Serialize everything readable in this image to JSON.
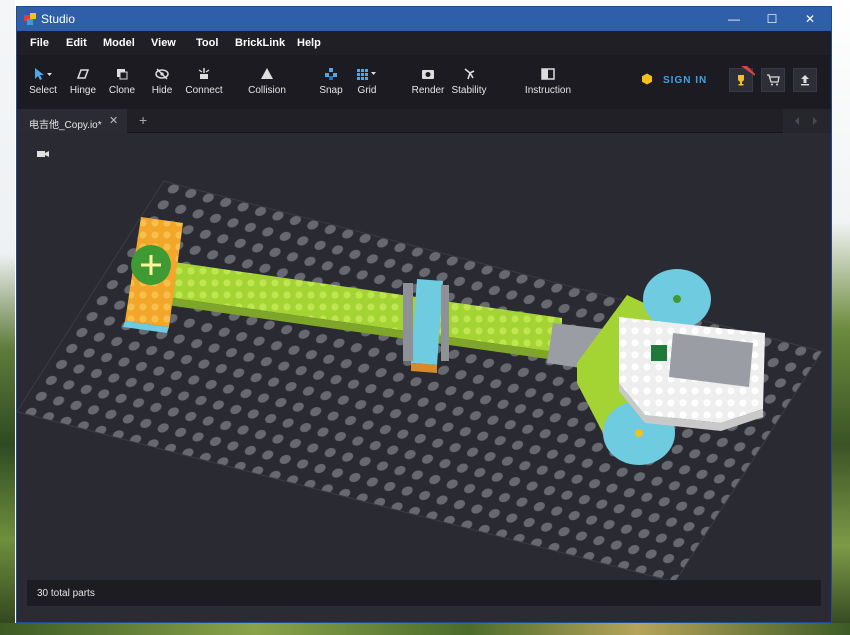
{
  "window": {
    "title": "Studio",
    "controls": {
      "minimize": "—",
      "maximize": "☐",
      "close": "✕"
    }
  },
  "menu": [
    "File",
    "Edit",
    "Model",
    "View",
    "Tool",
    "BrickLink",
    "Help"
  ],
  "toolbar": {
    "select": "Select",
    "hinge": "Hinge",
    "clone": "Clone",
    "hide": "Hide",
    "connect": "Connect",
    "collision": "Collision",
    "snap": "Snap",
    "grid": "Grid",
    "render": "Render",
    "stability": "Stability",
    "instruction": "Instruction",
    "sign_in": "SIGN IN"
  },
  "tabs": {
    "active": "电吉他_Copy.io*",
    "close": "✕",
    "add": "+"
  },
  "status": {
    "text": "30 total parts"
  },
  "colors": {
    "titlebar": "#2f5fa8",
    "menubar": "#1f1f25",
    "toolbar": "#1b1b21",
    "viewport": "#2a2a33",
    "accent": "#3ea4e6",
    "brick_green": "#a4d434",
    "brick_orange": "#f4ae2c",
    "brick_azure": "#6ecbe0",
    "brick_white": "#f5f5f5",
    "brick_gray": "#8e9297"
  }
}
